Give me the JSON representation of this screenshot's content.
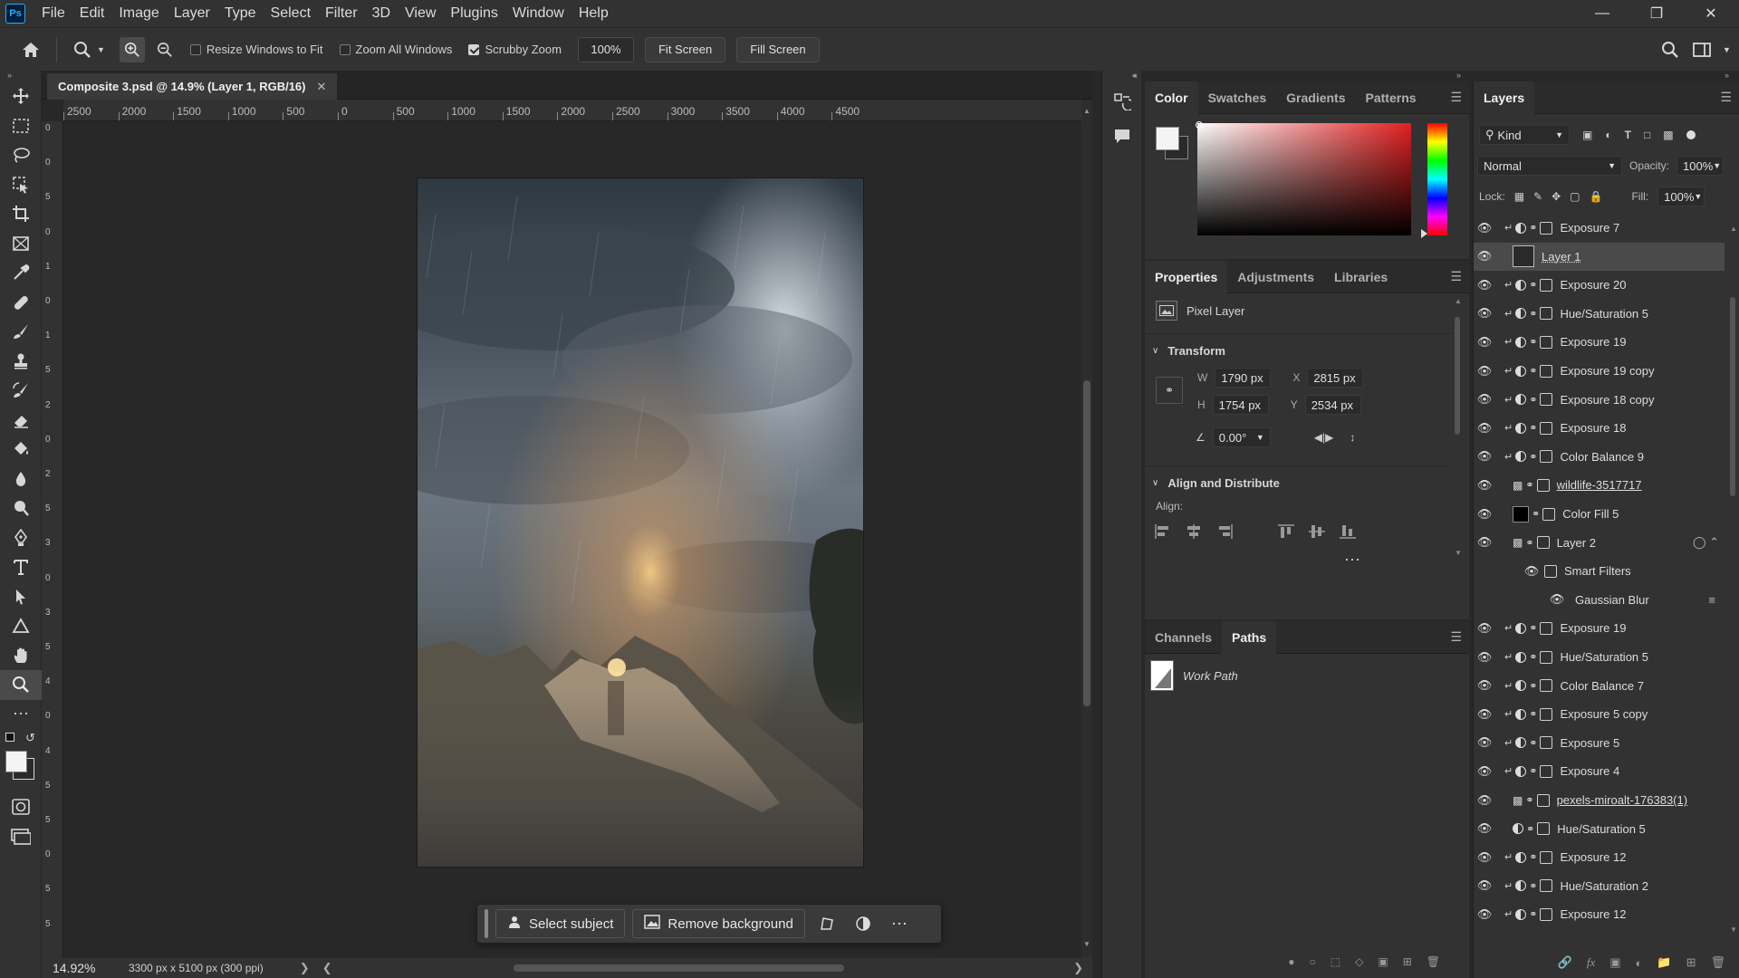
{
  "app": {
    "logo": "Ps"
  },
  "menubar": {
    "items": [
      "File",
      "Edit",
      "Image",
      "Layer",
      "Type",
      "Select",
      "Filter",
      "3D",
      "View",
      "Plugins",
      "Window",
      "Help"
    ]
  },
  "options_bar": {
    "resize_windows": {
      "label": "Resize Windows to Fit",
      "checked": false
    },
    "zoom_all": {
      "label": "Zoom All Windows",
      "checked": false
    },
    "scrubby": {
      "label": "Scrubby Zoom",
      "checked": true
    },
    "zoom_value": "100%",
    "fit_screen": "Fit Screen",
    "fill_screen": "Fill Screen"
  },
  "document": {
    "tab_title": "Composite 3.psd @ 14.9% (Layer 1, RGB/16)"
  },
  "ruler_h_labels": [
    "2500",
    "2000",
    "1500",
    "1000",
    "500",
    "0",
    "500",
    "1000",
    "1500",
    "2000",
    "2500",
    "3000",
    "3500",
    "4000",
    "4500"
  ],
  "ruler_v_labels": [
    "0",
    "0",
    "5",
    "0",
    "1",
    "0",
    "1",
    "5",
    "2",
    "0",
    "2",
    "5",
    "3",
    "0",
    "3",
    "5",
    "4",
    "0",
    "4",
    "5",
    "5",
    "0",
    "5",
    "5"
  ],
  "status": {
    "zoom": "14.92%",
    "doc_info": "3300 px x 5100 px (300 ppi)"
  },
  "context_bar": {
    "select_subject": "Select subject",
    "remove_background": "Remove background"
  },
  "color_panel": {
    "tabs": [
      "Color",
      "Swatches",
      "Gradients",
      "Patterns"
    ],
    "active": "Color",
    "accent": "#e02020"
  },
  "properties_panel": {
    "tabs": [
      "Properties",
      "Adjustments",
      "Libraries"
    ],
    "type_label": "Pixel Layer",
    "transform": {
      "title": "Transform",
      "w_label": "W",
      "w": "1790 px",
      "h_label": "H",
      "h": "1754 px",
      "x_label": "X",
      "x": "2815 px",
      "y_label": "Y",
      "y": "2534 px",
      "angle": "0.00°"
    },
    "align": {
      "title": "Align and Distribute",
      "label": "Align:"
    }
  },
  "paths_panel": {
    "tabs": [
      "Channels",
      "Paths"
    ],
    "active": "Paths",
    "item": "Work Path"
  },
  "layers_panel": {
    "tab": "Layers",
    "filter_kind": "Kind",
    "blend_mode": "Normal",
    "opacity_label": "Opacity:",
    "opacity": "100%",
    "lock_label": "Lock:",
    "fill_label": "Fill:",
    "fill": "100%",
    "layers": [
      {
        "name": "Exposure 7",
        "kind": "adj",
        "clip": true
      },
      {
        "name": "Layer 1",
        "kind": "pixel",
        "selected": true
      },
      {
        "name": "Exposure 20",
        "kind": "adj",
        "clip": true
      },
      {
        "name": "Hue/Saturation 5",
        "kind": "adj",
        "clip": true
      },
      {
        "name": "Exposure 19",
        "kind": "adj",
        "clip": true
      },
      {
        "name": "Exposure 19 copy",
        "kind": "adj",
        "clip": true
      },
      {
        "name": "Exposure 18 copy",
        "kind": "adj",
        "clip": true
      },
      {
        "name": "Exposure 18",
        "kind": "adj",
        "clip": true
      },
      {
        "name": "Color Balance 9",
        "kind": "adj",
        "clip": true
      },
      {
        "name": "wildlife-3517717",
        "kind": "smart",
        "underline": true
      },
      {
        "name": "Color Fill 5",
        "kind": "fill"
      },
      {
        "name": "Layer 2",
        "kind": "smart"
      },
      {
        "name": "Smart Filters",
        "kind": "sub"
      },
      {
        "name": "Gaussian Blur",
        "kind": "subfilter"
      },
      {
        "name": "Exposure 19",
        "kind": "adj",
        "clip": true
      },
      {
        "name": "Hue/Saturation 5",
        "kind": "adj",
        "clip": true
      },
      {
        "name": "Color Balance 7",
        "kind": "adj",
        "clip": true
      },
      {
        "name": "Exposure 5 copy",
        "kind": "adj",
        "clip": true
      },
      {
        "name": "Exposure 5",
        "kind": "adj",
        "clip": true
      },
      {
        "name": "Exposure 4",
        "kind": "adj",
        "clip": true
      },
      {
        "name": "pexels-miroalt-176383(1)",
        "kind": "smart",
        "underline": true
      },
      {
        "name": "Hue/Saturation 5",
        "kind": "adj"
      },
      {
        "name": "Exposure 12",
        "kind": "adj",
        "clip": true
      },
      {
        "name": "Hue/Saturation 2",
        "kind": "adj",
        "clip": true
      },
      {
        "name": "Exposure 12",
        "kind": "adj",
        "clip": true
      },
      {
        "name": "Exposure 12",
        "kind": "adj",
        "clip": true
      }
    ]
  }
}
